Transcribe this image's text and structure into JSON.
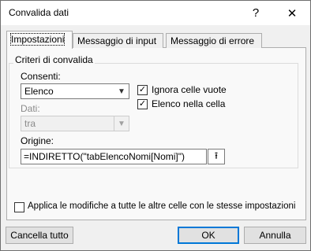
{
  "window": {
    "title": "Convalida dati",
    "help": "?",
    "close": "✕"
  },
  "tabs": [
    {
      "label": "Impostazioni",
      "active": true
    },
    {
      "label": "Messaggio di input",
      "active": false
    },
    {
      "label": "Messaggio di errore",
      "active": false
    }
  ],
  "criteria": {
    "group_label": "Criteri di convalida",
    "allow_label": "Consenti:",
    "allow_value": "Elenco",
    "data_label": "Dati:",
    "data_value": "tra",
    "ignore_blank_label": "Ignora celle vuote",
    "ignore_blank_checked": true,
    "in_cell_dropdown_label": "Elenco nella cella",
    "in_cell_dropdown_checked": true,
    "source_label": "Origine:",
    "source_value": "=INDIRETTO(\"tabElencoNomi[Nomi]\")"
  },
  "apply_all": {
    "label": "Applica le modifiche a tutte le altre celle con le stesse impostazioni",
    "checked": false
  },
  "buttons": {
    "clear_all": "Cancella tutto",
    "ok": "OK",
    "cancel": "Annulla"
  }
}
